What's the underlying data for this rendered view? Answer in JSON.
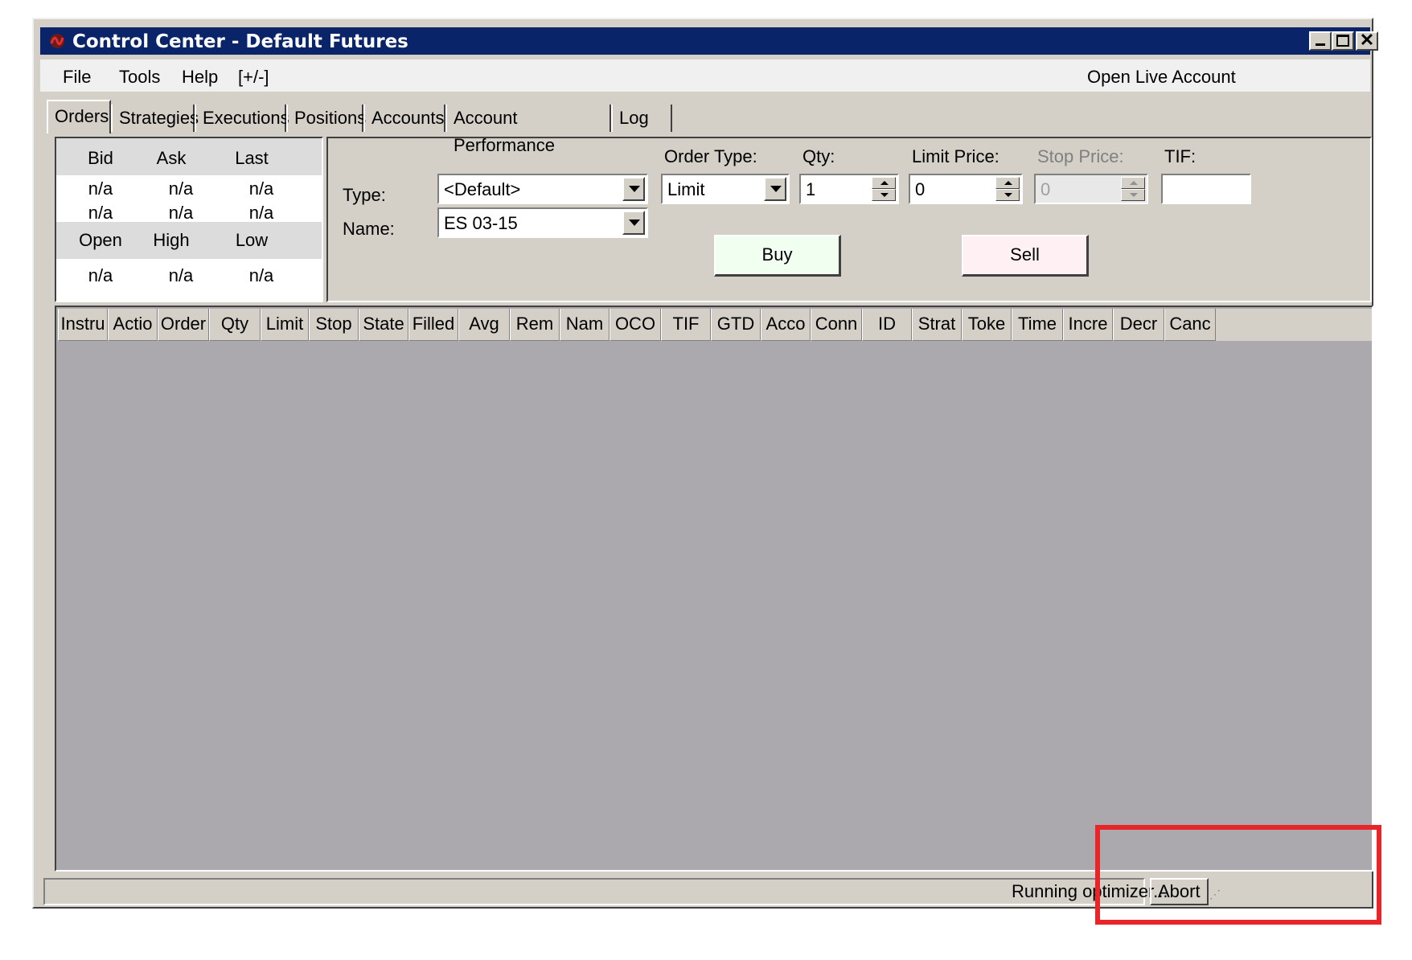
{
  "window": {
    "title": "Control Center - Default Futures",
    "controls": [
      "minimize",
      "maximize",
      "close"
    ]
  },
  "menu": {
    "items": [
      "File",
      "Tools",
      "Help",
      "[+/-]"
    ],
    "right_link": "Open Live Account"
  },
  "tabs": [
    "Orders",
    "Strategies",
    "Executions",
    "Positions",
    "Accounts",
    "Account Performance",
    "Log"
  ],
  "active_tab": "Orders",
  "quote": {
    "headers1": [
      "Bid",
      "Ask",
      "Last"
    ],
    "row1": [
      "n/a",
      "n/a",
      "n/a"
    ],
    "row2": [
      "n/a",
      "n/a",
      "n/a"
    ],
    "headers2": [
      "Open",
      "High",
      "Low"
    ],
    "row3": [
      "n/a",
      "n/a",
      "n/a"
    ]
  },
  "order_entry": {
    "type_label": "Type:",
    "type_value": "<Default>",
    "name_label": "Name:",
    "name_value": "ES 03-15",
    "order_type_label": "Order Type:",
    "order_type_value": "Limit",
    "qty_label": "Qty:",
    "qty_value": "1",
    "limit_price_label": "Limit Price:",
    "limit_price_value": "0",
    "stop_price_label": "Stop Price:",
    "stop_price_value": "0",
    "tif_label": "TIF:",
    "tif_value": "",
    "buy_label": "Buy",
    "sell_label": "Sell",
    "buy_color": "#f0fff0",
    "sell_color": "#fff0f4"
  },
  "grid": {
    "columns": [
      "Instru",
      "Actio",
      "Order",
      "Qty",
      "Limit",
      "Stop",
      "State",
      "Filled",
      "Avg",
      "Rem",
      "Nam",
      "OCO",
      "TIF",
      "GTD",
      "Acco",
      "Conn",
      "ID",
      "Strat",
      "Toke",
      "Time",
      "Incre",
      "Decr",
      "Canc"
    ]
  },
  "status": {
    "text": "Running optimizer...",
    "abort_label": "Abort"
  },
  "colors": {
    "titlebar": "#0a246a",
    "highlight": "#e8262a",
    "grid_bg": "#aba9ae"
  }
}
